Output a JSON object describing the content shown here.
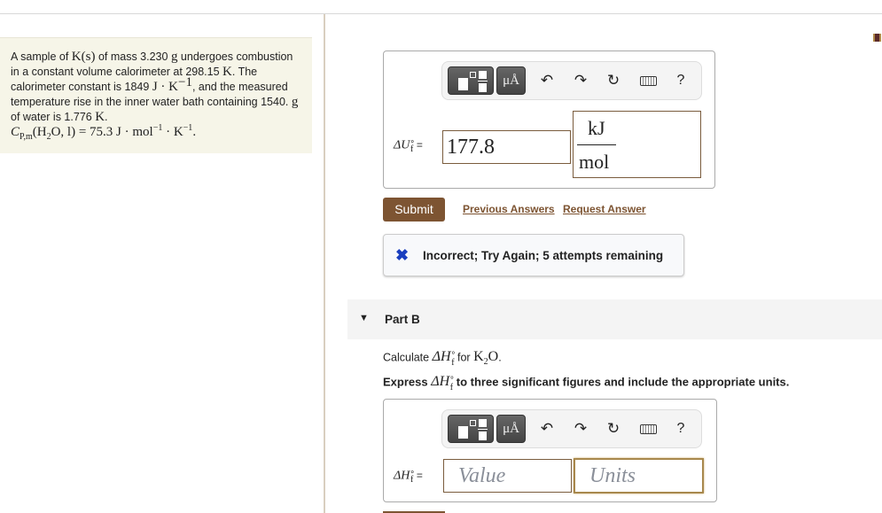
{
  "problem": {
    "text_segments": [
      "A sample of ",
      "K(s)",
      " of mass 3.230 ",
      "g",
      " undergoes combustion in a constant volume calorimeter at 298.15 ",
      "K",
      ". The calorimeter constant is 1849 ",
      "J · K",
      "−1",
      ", and the measured temperature rise in the inner water bath containing 1540. ",
      "g",
      " of water is 1.776 ",
      "K",
      "."
    ],
    "cp_line": {
      "symbol": "C",
      "subscript": "P,m",
      "species": "(H",
      "species_sub": "2",
      "species_rest": "O, l) = 75.3 J · mol",
      "exp1": "−1",
      "mid": " · K",
      "exp2": "−1",
      "end": "."
    }
  },
  "toolbar": {
    "template_icon": "fraction-template-icon",
    "units_label": "μÅ",
    "undo_icon": "↶",
    "redo_icon": "↷",
    "reset_icon": "↻",
    "keyboard_icon": "keyboard-icon",
    "help_label": "?"
  },
  "part_a": {
    "label_symbol": "ΔU",
    "label_sub": "f",
    "label_sup": "∘",
    "equals": "=",
    "value": "177.8",
    "units_numerator": "kJ",
    "units_denominator": "mol",
    "submit_label": "Submit",
    "previous_answers_label": "Previous Answers",
    "request_answer_label": "Request Answer",
    "feedback_icon": "✖",
    "feedback_message": "Incorrect; Try Again; 5 attempts remaining"
  },
  "part_b": {
    "title": "Part B",
    "caret": "▼",
    "question_prefix": "Calculate ",
    "question_symbol": "ΔH",
    "question_sub": "f",
    "question_sup": "∘",
    "question_mid": " for ",
    "question_compound": "K",
    "question_compound_sub": "2",
    "question_compound_rest": "O",
    "question_end": ".",
    "instruction_prefix": "Express ",
    "instruction_symbol": "ΔH",
    "instruction_sub": "f",
    "instruction_sup": "∘",
    "instruction_rest": " to three significant figures and include the appropriate units.",
    "label_symbol": "ΔH",
    "label_sub": "f",
    "label_sup": "∘",
    "equals": "=",
    "value_placeholder": "Value",
    "units_placeholder": "Units"
  }
}
